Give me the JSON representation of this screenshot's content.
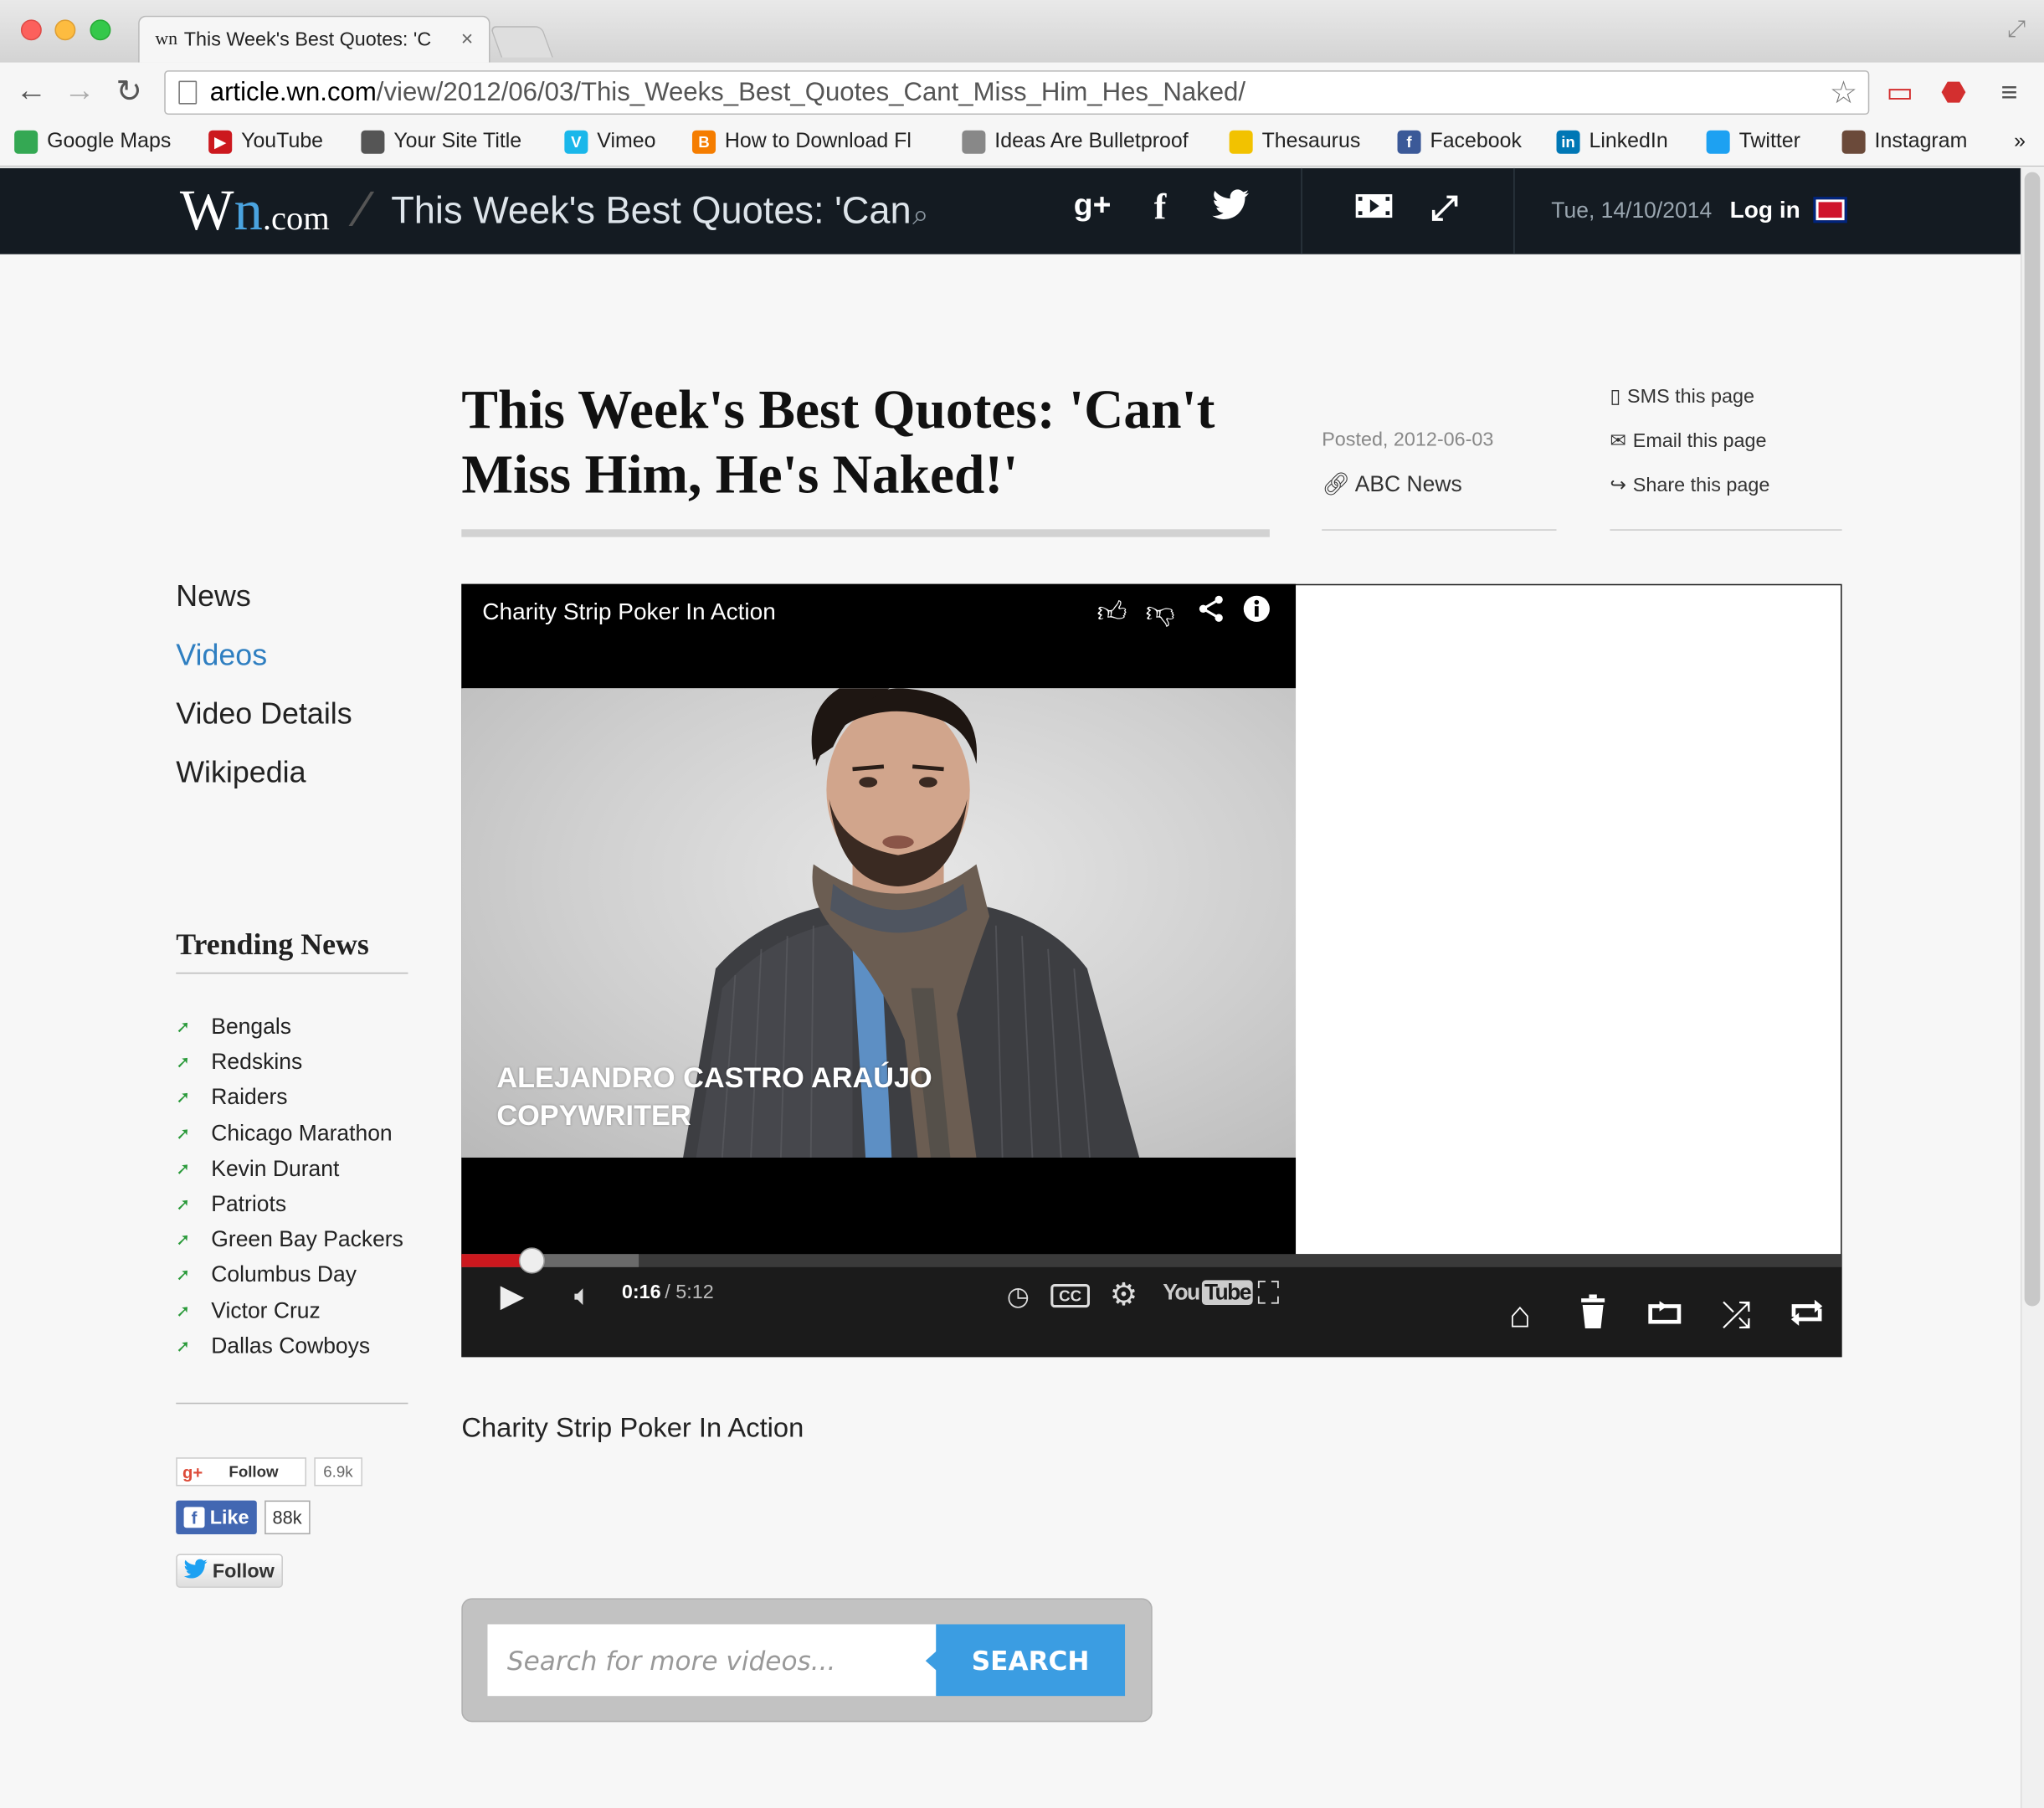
{
  "browser": {
    "tab_title": "This Week's Best Quotes: 'C",
    "tab_favicon": "wn",
    "tab_close": "×",
    "url_domain": "article.wn.com",
    "url_path": "/view/2012/06/03/This_Weeks_Best_Quotes_Cant_Miss_Him_Hes_Naked/",
    "bookmarks": [
      {
        "label": "Google Maps",
        "color": "#34a853",
        "glyph": ""
      },
      {
        "label": "YouTube",
        "color": "#cc181e",
        "glyph": "▶"
      },
      {
        "label": "Your Site Title",
        "color": "#555555",
        "glyph": ""
      },
      {
        "label": "Vimeo",
        "color": "#1ab7ea",
        "glyph": "V"
      },
      {
        "label": "How to Download Fl",
        "color": "#f57d00",
        "glyph": "B"
      },
      {
        "label": "Ideas Are Bulletproof",
        "color": "#888888",
        "glyph": ""
      },
      {
        "label": "Thesaurus",
        "color": "#f2c200",
        "glyph": ""
      },
      {
        "label": "Facebook",
        "color": "#3b5998",
        "glyph": "f"
      },
      {
        "label": "LinkedIn",
        "color": "#0077b5",
        "glyph": "in"
      },
      {
        "label": "Twitter",
        "color": "#1da1f2",
        "glyph": ""
      },
      {
        "label": "Instagram",
        "color": "#6b4a3a",
        "glyph": ""
      }
    ],
    "bookmarks_more": "»"
  },
  "header": {
    "logo_w": "W",
    "logo_n": "n",
    "logo_com": ".com",
    "separator": "/",
    "title": "This Week's Best Quotes: 'Can't",
    "search_glyph": "⌕",
    "gplus": "g+",
    "facebook": "f",
    "twitter": "t",
    "date": "Tue, 14/10/2014",
    "login": "Log in"
  },
  "article": {
    "title": "This Week's Best Quotes: 'Can't Miss Him, He's Naked!'",
    "posted": "Posted, 2012-06-03",
    "source": "ABC News",
    "share_links": [
      {
        "icon": "phone-icon",
        "glyph": "▯",
        "label": "SMS this page"
      },
      {
        "icon": "envelope-icon",
        "glyph": "✉",
        "label": "Email this page"
      },
      {
        "icon": "share-icon",
        "glyph": "↪",
        "label": "Share this page"
      }
    ],
    "caption": "Charity Strip Poker In Action"
  },
  "sidebar": {
    "nav": [
      {
        "label": "News",
        "active": false
      },
      {
        "label": "Videos",
        "active": true
      },
      {
        "label": "Video Details",
        "active": false
      },
      {
        "label": "Wikipedia",
        "active": false
      }
    ],
    "trending_title": "Trending News",
    "trending": [
      "Bengals",
      "Redskins",
      "Raiders",
      "Chicago Marathon",
      "Kevin Durant",
      "Patriots",
      "Green Bay Packers",
      "Columbus Day",
      "Victor Cruz",
      "Dallas Cowboys"
    ]
  },
  "social": {
    "gplus_follow": "Follow",
    "gplus_count": "6.9k",
    "fb_like": "Like",
    "fb_count": "88k",
    "tw_follow": "Follow"
  },
  "player": {
    "title": "Charity Strip Poker In Action",
    "lower_third_name": "ALEJANDRO CASTRO ARAÚJO",
    "lower_third_role": "COPYWRITER",
    "time_current": "0:16",
    "time_duration": " / 5:12",
    "progress_fraction": 0.051,
    "buffered_fraction": 0.128,
    "youtube_you": "You",
    "youtube_tube": "Tube"
  },
  "search": {
    "placeholder": "Search for more videos...",
    "button": "SEARCH"
  },
  "colors": {
    "accent": "#3b9de2",
    "header_bg": "#141b22",
    "active_link": "#2f7fc1",
    "progress": "#cc181e"
  }
}
